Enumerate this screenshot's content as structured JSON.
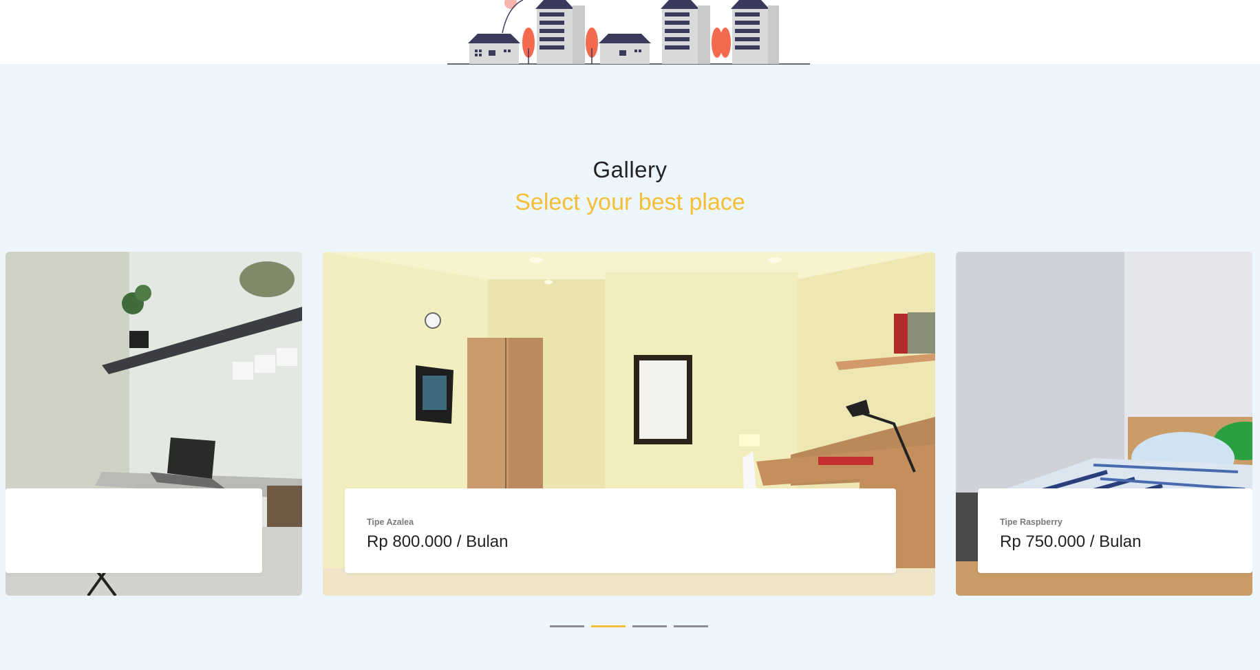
{
  "gallery": {
    "heading": "Gallery",
    "subheading": "Select your best place"
  },
  "cards": [
    {
      "type": "",
      "price": "",
      "image": "room-with-shelf-and-laptop"
    },
    {
      "type": "Tipe Azalea",
      "price": "Rp 800.000 / Bulan",
      "image": "room-with-wardrobe-and-desk"
    },
    {
      "type": "Tipe Raspberry",
      "price": "Rp 750.000 / Bulan",
      "image": "room-with-bed-and-pillows"
    }
  ],
  "carousel": {
    "slides": 4,
    "active_index": 1
  },
  "colors": {
    "accent": "#f3bf37",
    "background": "#edf6fd",
    "building": "#3a3a5c",
    "tree": "#f46a4e"
  }
}
